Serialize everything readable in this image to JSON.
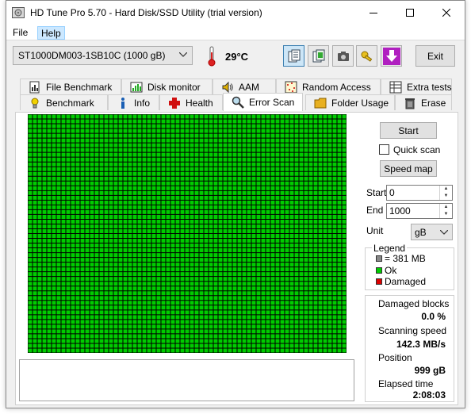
{
  "window": {
    "title": "HD Tune Pro 5.70 - Hard Disk/SSD Utility (trial version)"
  },
  "menu": {
    "file_label": "File",
    "help_label": "Help"
  },
  "toolbar": {
    "drive": "ST1000DM003-1SB10C (1000 gB)",
    "temperature": "29°C",
    "exit_label": "Exit",
    "buttons": [
      "copy-text-icon",
      "copy-screenshot-icon",
      "camera-icon",
      "key-icon",
      "download-arrow-icon"
    ]
  },
  "tabs": {
    "row1": [
      "File Benchmark",
      "Disk monitor",
      "AAM",
      "Random Access",
      "Extra tests"
    ],
    "row2": [
      "Benchmark",
      "Info",
      "Health",
      "Error Scan",
      "Folder Usage",
      "Erase"
    ],
    "active": "Error Scan"
  },
  "scan": {
    "start_button": "Start",
    "quick_scan_label": "Quick scan",
    "quick_scan_checked": false,
    "speed_map_button": "Speed map",
    "start_label": "Start",
    "start_value": "0",
    "end_label": "End",
    "end_value": "1000",
    "unit_label": "Unit",
    "unit_value": "gB",
    "grid_color": "#00cc00"
  },
  "legend": {
    "title": "Legend",
    "block_size": "= 381 MB",
    "ok": "Ok",
    "damaged": "Damaged",
    "ok_color": "#00cc00",
    "damaged_color": "#dd0000"
  },
  "stats": {
    "damaged_blocks_label": "Damaged blocks",
    "damaged_blocks_value": "0.0 %",
    "scanning_speed_label": "Scanning speed",
    "scanning_speed_value": "142.3 MB/s",
    "position_label": "Position",
    "position_value": "999 gB",
    "elapsed_label": "Elapsed time",
    "elapsed_value": "2:08:03"
  }
}
